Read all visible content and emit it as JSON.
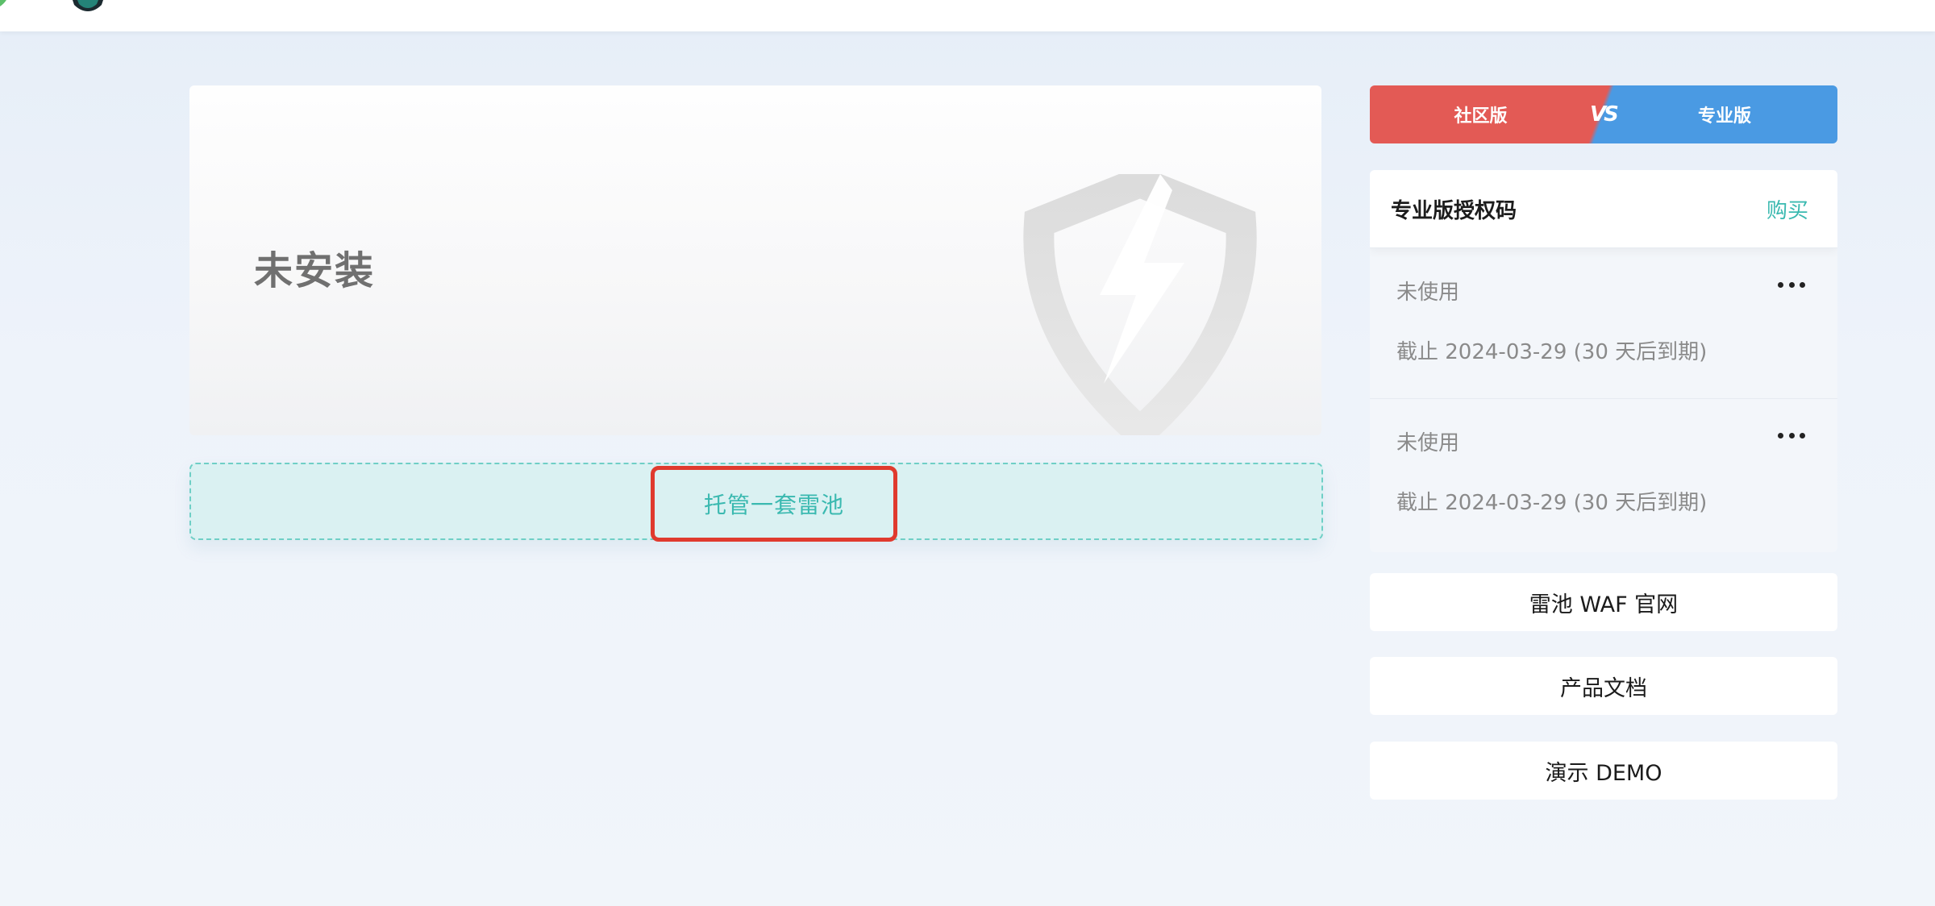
{
  "status": {
    "text": "未安装"
  },
  "host": {
    "button_label": "托管一套雷池"
  },
  "version_compare": {
    "community_label": "社区版",
    "vs_label": "VS",
    "pro_label": "专业版",
    "colors": {
      "community": "#e35a55",
      "pro": "#4a9ae3"
    }
  },
  "license": {
    "title": "专业版授权码",
    "buy_label": "购买",
    "items": [
      {
        "status": "未使用",
        "expire": "截止 2024-03-29 (30 天后到期)"
      },
      {
        "status": "未使用",
        "expire": "截止 2024-03-29 (30 天后到期)"
      }
    ]
  },
  "links": {
    "official_site": "雷池 WAF 官网",
    "docs": "产品文档",
    "demo": "演示 DEMO"
  },
  "icons": {
    "logo": "shield-logo-icon",
    "illustration": "shield-lightning-icon",
    "more": "more-dots-icon"
  },
  "accent_color": "#3ab9b0"
}
